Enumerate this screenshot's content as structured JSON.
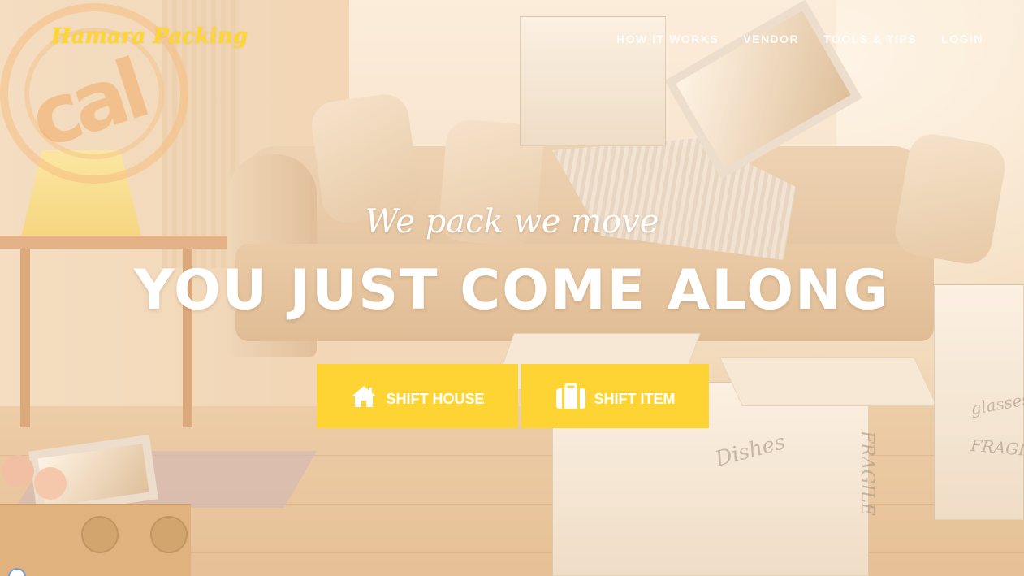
{
  "brand": {
    "name": "Hamara Packing"
  },
  "nav": {
    "items": [
      {
        "label": "HOW IT WORKS"
      },
      {
        "label": "VENDOR"
      },
      {
        "label": "TOOLS & TIPS"
      },
      {
        "label": "LOGIN"
      }
    ]
  },
  "hero": {
    "tagline": "We pack we move",
    "headline": "YOU JUST COME ALONG",
    "background_scribbles": [
      "Dishes",
      "FRAGILE",
      "glasses",
      "FRAGILE"
    ]
  },
  "cta": {
    "shift_house": {
      "label": "SHIFT HOUSE",
      "icon": "home-icon"
    },
    "shift_item": {
      "label": "SHIFT ITEM",
      "icon": "briefcase-icon"
    }
  },
  "colors": {
    "accent": "#fdd434",
    "brand_text": "#ffd62e",
    "text_light": "#ffffff"
  }
}
